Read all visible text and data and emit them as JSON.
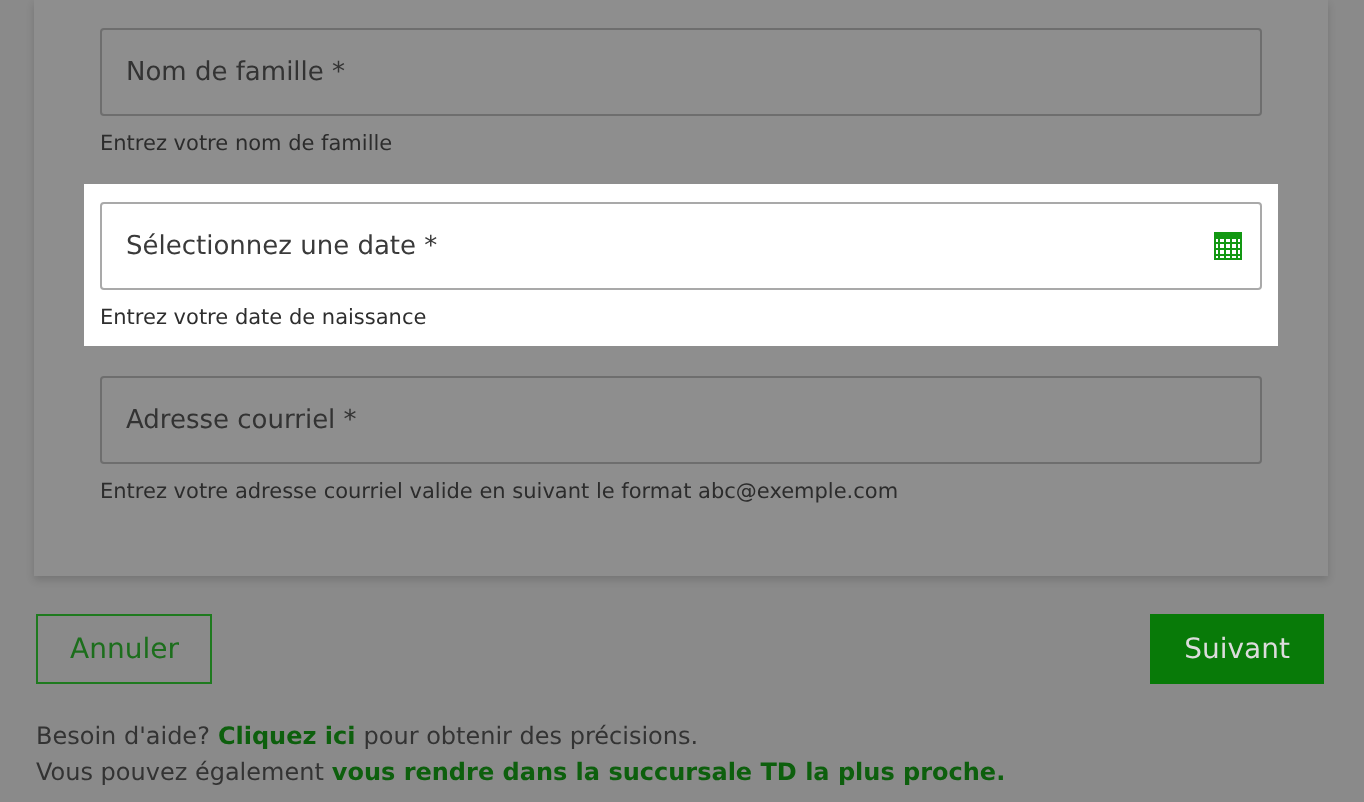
{
  "fields": [
    {
      "kind": "text",
      "placeholder": "Nom de famille *",
      "helper": "Entrez votre nom de famille",
      "highlighted": false
    },
    {
      "kind": "date",
      "placeholder": "Sélectionnez une date *",
      "helper": "Entrez votre date de naissance",
      "highlighted": true
    },
    {
      "kind": "text",
      "placeholder": "Adresse courriel *",
      "helper": "Entrez votre adresse courriel valide en suivant le format abc@exemple.com",
      "highlighted": false
    }
  ],
  "buttons": [
    {
      "label": "Annuler",
      "kind": "secondary"
    },
    {
      "label": "Suivant",
      "kind": "primary"
    }
  ],
  "help": [
    [
      {
        "kind": "text",
        "text": "Besoin d'aide?"
      },
      {
        "kind": "link",
        "text": "Cliquez ici"
      },
      {
        "kind": "text",
        "text": "pour obtenir des précisions."
      }
    ],
    [
      {
        "kind": "text",
        "text": "Vous pouvez également"
      },
      {
        "kind": "link",
        "text": "vous rendre dans la succursale TD la plus proche."
      }
    ]
  ]
}
